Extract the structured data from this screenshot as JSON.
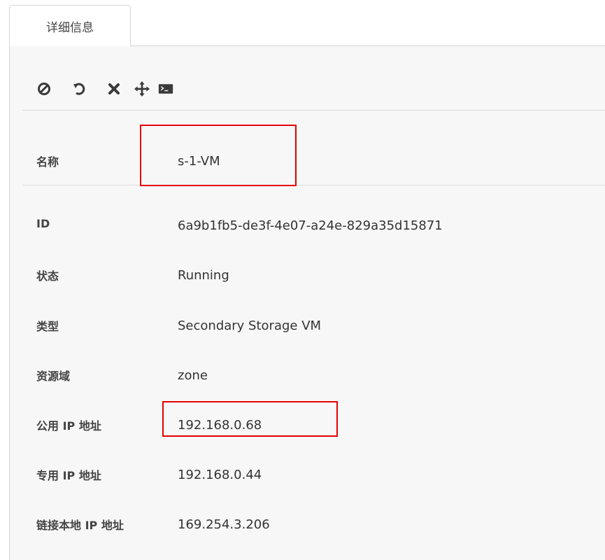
{
  "tabs": [
    {
      "label": "详细信息",
      "active": true
    }
  ],
  "toolbar": {
    "actions": [
      {
        "icon": "stop-icon",
        "label": "stop"
      },
      {
        "icon": "reboot-icon",
        "label": "reboot"
      },
      {
        "icon": "destroy-icon",
        "label": "destroy"
      },
      {
        "icon": "migrate-icon",
        "label": "migrate"
      },
      {
        "icon": "console-icon",
        "label": "console"
      }
    ]
  },
  "details": {
    "name": {
      "label": "名称",
      "value": "s-1-VM"
    },
    "id": {
      "label": "ID",
      "value": "6a9b1fb5-de3f-4e07-a24e-829a35d15871"
    },
    "state": {
      "label": "状态",
      "value": "Running"
    },
    "type": {
      "label": "类型",
      "value": "Secondary Storage VM"
    },
    "zone": {
      "label": "资源域",
      "value": "zone"
    },
    "public_ip": {
      "label": "公用 IP 地址",
      "value": "192.168.0.68"
    },
    "private_ip": {
      "label": "专用 IP 地址",
      "value": "192.168.0.44"
    },
    "link_local_ip": {
      "label": "链接本地 IP 地址",
      "value": "169.254.3.206"
    }
  },
  "colors": {
    "highlight": "#e60000",
    "panel_bg": "#f7f7f7",
    "icon": "#3a3a3a"
  }
}
